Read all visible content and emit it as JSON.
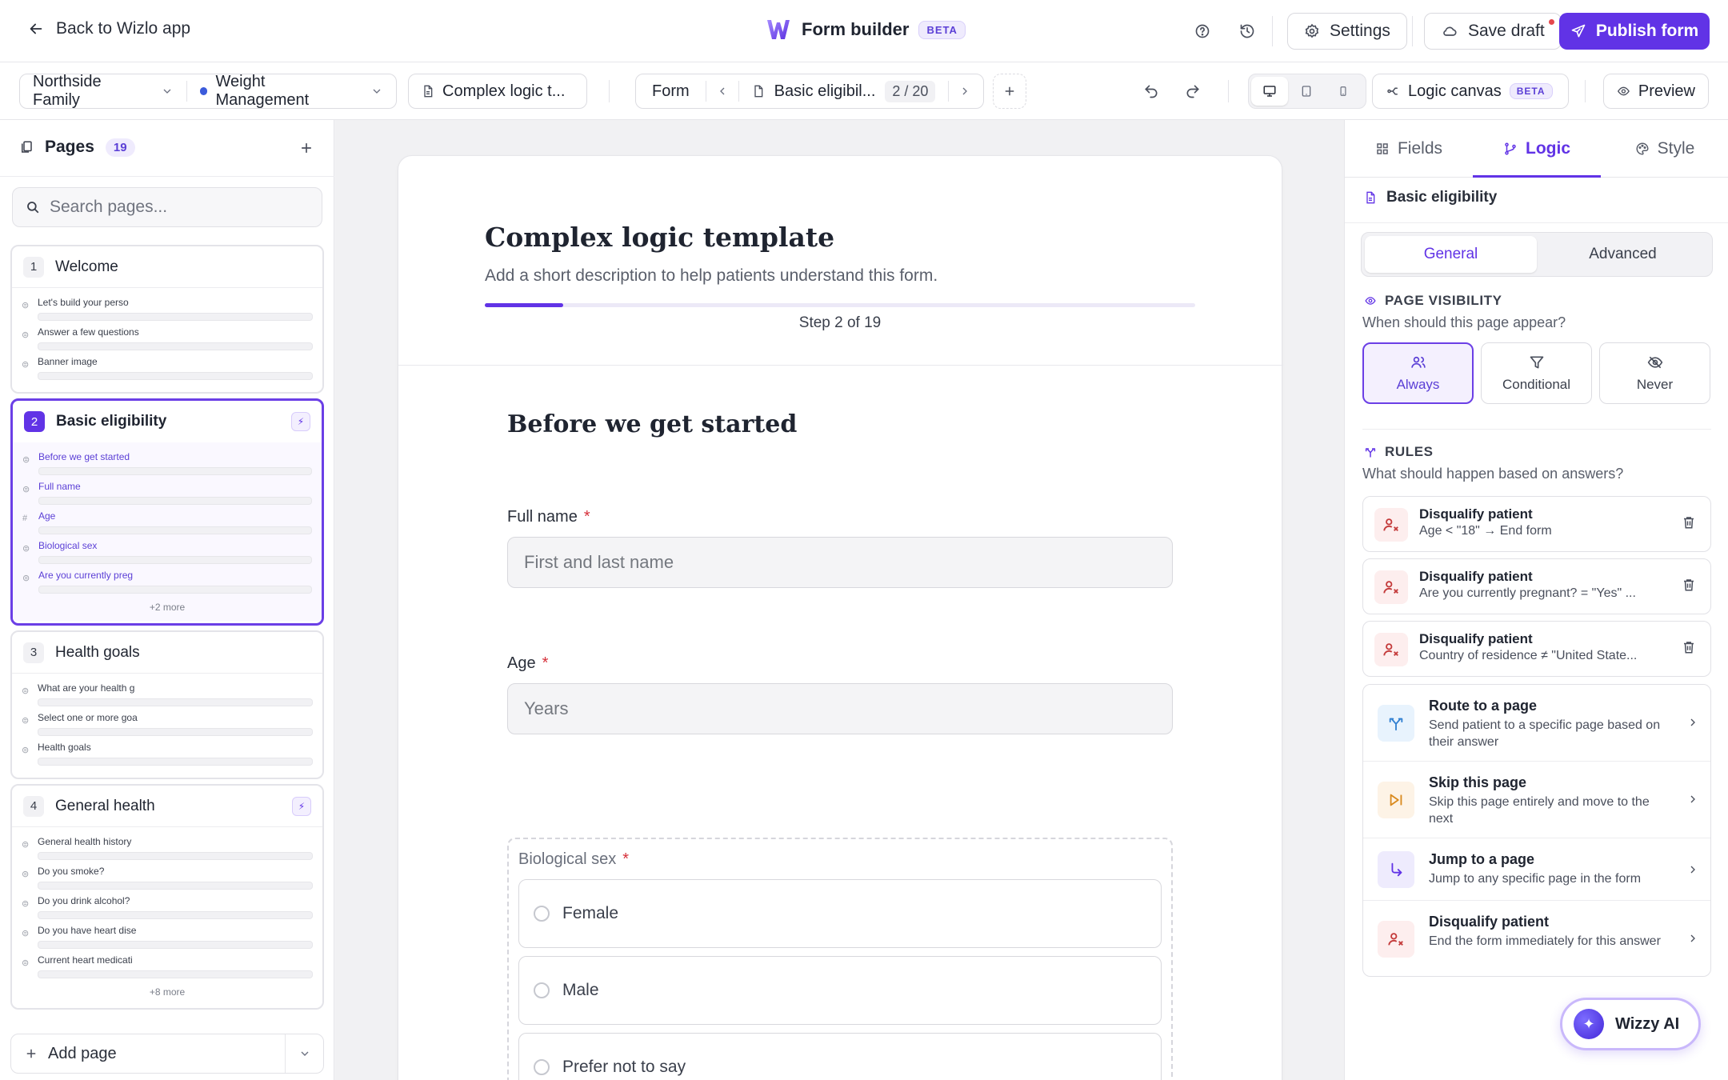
{
  "topbar": {
    "back_label": "Back to Wizlo app",
    "title": "Form builder",
    "badge": "BETA",
    "settings_label": "Settings",
    "save_draft_label": "Save draft",
    "publish_label": "Publish form"
  },
  "toolbar": {
    "org": "Northside Family",
    "program": "Weight Management",
    "form_name": "Complex logic t...",
    "form_tab": "Form",
    "page_name": "Basic eligibil...",
    "page_counter": "2 / 20",
    "logic_canvas_label": "Logic canvas",
    "logic_canvas_badge": "BETA",
    "preview_label": "Preview"
  },
  "sidebar": {
    "title": "Pages",
    "count": "19",
    "search_placeholder": "Search pages...",
    "add_page_label": "Add page",
    "pages": [
      {
        "num": "1",
        "title": "Welcome",
        "fields": [
          "Let's build your perso",
          "Answer a few questions",
          "Banner image"
        ],
        "more": ""
      },
      {
        "num": "2",
        "title": "Basic eligibility",
        "fields": [
          "Before we get started",
          "Full name",
          "Age",
          "Biological sex",
          "Are you currently preg"
        ],
        "more": "+2 more"
      },
      {
        "num": "3",
        "title": "Health goals",
        "fields": [
          "What are your health g",
          "Select one or more goa",
          "Health goals"
        ],
        "more": ""
      },
      {
        "num": "4",
        "title": "General health",
        "fields": [
          "General health history",
          "Do you smoke?",
          "Do you drink alcohol?",
          "Do you have heart dise",
          "Current heart medicati"
        ],
        "more": "+8 more"
      }
    ]
  },
  "form": {
    "title": "Complex logic template",
    "description": "Add a short description to help patients understand this form.",
    "progress": 0.11,
    "step_text": "Step 2 of 19",
    "section_title": "Before we get started",
    "full_name_label": "Full name",
    "full_name_placeholder": "First and last name",
    "age_label": "Age",
    "age_placeholder": "Years",
    "sex_label": "Biological sex",
    "sex_options": [
      "Female",
      "Male",
      "Prefer not to say"
    ],
    "required_mark": "*"
  },
  "panel": {
    "tabs": [
      "Fields",
      "Logic",
      "Style"
    ],
    "active_tab": "Logic",
    "page_name": "Basic eligibility",
    "subtabs": [
      "General",
      "Advanced"
    ],
    "visibility_title": "PAGE VISIBILITY",
    "visibility_sub": "When should this page appear?",
    "visibility_options": [
      "Always",
      "Conditional",
      "Never"
    ],
    "rules_title": "RULES",
    "rules_sub": "What should happen based on answers?",
    "rules": [
      {
        "title": "Disqualify patient",
        "desc": "Age < \"18\" → End form"
      },
      {
        "title": "Disqualify patient",
        "desc": "Are you currently pregnant? = \"Yes\" ..."
      },
      {
        "title": "Disqualify patient",
        "desc": "Country of residence ≠ \"United State..."
      }
    ],
    "actions": [
      {
        "title": "Route to a page",
        "desc": "Send patient to a specific page based on their answer"
      },
      {
        "title": "Skip this page",
        "desc": "Skip this page entirely and move to the next"
      },
      {
        "title": "Jump to a page",
        "desc": "Jump to any specific page in the form"
      },
      {
        "title": "Disqualify patient",
        "desc": "End the form immediately for this answer"
      }
    ]
  },
  "assistant": {
    "label": "Wizzy AI"
  },
  "colors": {
    "accent": "#6133e6",
    "required": "#d6303a",
    "disqualify_bg": "#fdeeee"
  }
}
